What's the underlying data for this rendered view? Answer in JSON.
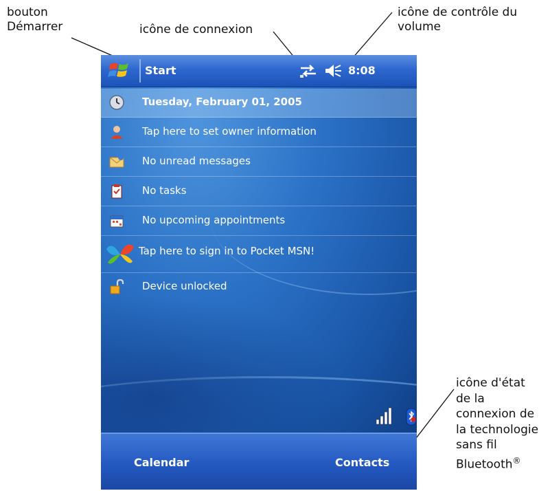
{
  "callouts": {
    "start_button": [
      "bouton",
      "Démarrer"
    ],
    "connection_icon": "icône de connexion",
    "volume_icon": [
      "icône de contrôle du",
      "volume"
    ],
    "bluetooth_icon": [
      "icône d'état",
      "de la",
      "connexion de",
      "la technologie",
      "sans fil",
      "Bluetooth"
    ],
    "registered_mark": "®"
  },
  "device": {
    "titlebar": {
      "start_label": "Start",
      "time": "8:08"
    },
    "today_items": [
      {
        "icon": "clock-icon",
        "label": "Tuesday, February 01, 2005"
      },
      {
        "icon": "owner-icon",
        "label": "Tap here to set owner information"
      },
      {
        "icon": "envelope-icon",
        "label": "No unread messages"
      },
      {
        "icon": "tasks-icon",
        "label": "No tasks"
      },
      {
        "icon": "calendar-icon",
        "label": "No upcoming appointments"
      },
      {
        "icon": "msn-butterfly-icon",
        "label": "Tap here to sign in to Pocket MSN!"
      },
      {
        "icon": "padlock-icon",
        "label": "Device unlocked"
      }
    ],
    "softkeys": {
      "left": "Calendar",
      "right": "Contacts"
    }
  },
  "colors": {
    "titlebar": "#2e68cf",
    "today_background": "#1a56a8",
    "menubar": "#2358c0",
    "text": "#ffffff"
  }
}
